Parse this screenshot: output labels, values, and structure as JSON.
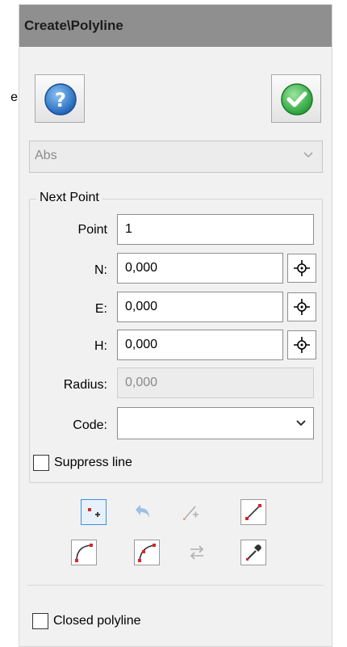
{
  "title": "Create\\Polyline",
  "side_glyph": "e",
  "mode_select": {
    "value": "Abs",
    "enabled": false
  },
  "group": {
    "legend": "Next Point",
    "point": {
      "label": "Point",
      "value": "1"
    },
    "n": {
      "label": "N:",
      "value": "0,000"
    },
    "e": {
      "label": "E:",
      "value": "0,000"
    },
    "h": {
      "label": "H:",
      "value": "0,000"
    },
    "radius": {
      "label": "Radius:",
      "value": "0,000",
      "enabled": false
    },
    "code": {
      "label": "Code:",
      "value": ""
    },
    "suppress_line": {
      "label": "Suppress line",
      "checked": false
    }
  },
  "toolbar": {
    "row1": [
      {
        "icon": "add-point-icon",
        "state": "selected"
      },
      {
        "icon": "undo-icon",
        "state": "disabled"
      },
      {
        "icon": "insert-point-icon",
        "state": "disabled"
      },
      {
        "icon": "line-segment-icon",
        "state": "enabled"
      }
    ],
    "row2": [
      {
        "icon": "arc-segment-icon",
        "state": "enabled"
      },
      {
        "icon": "arc-3-point-icon",
        "state": "enabled"
      },
      {
        "icon": "reverse-direction-icon",
        "state": "disabled"
      },
      {
        "icon": "eyedropper-icon",
        "state": "enabled"
      }
    ]
  },
  "closed_polyline": {
    "label": "Closed polyline",
    "checked": false
  },
  "colors": {
    "titlebar": "#8f8f8f",
    "help_blue": "#2f7fd0",
    "ok_green": "#3bb54a",
    "selection_blue": "#3f8fd8",
    "point_red": "#d9262c"
  }
}
